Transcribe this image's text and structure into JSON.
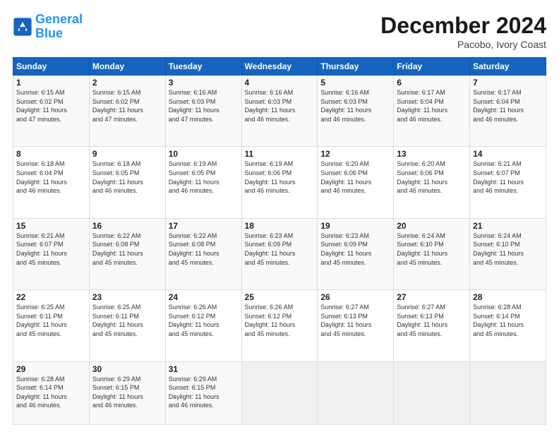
{
  "logo": {
    "line1": "General",
    "line2": "Blue"
  },
  "title": "December 2024",
  "subtitle": "Pacobo, Ivory Coast",
  "headers": [
    "Sunday",
    "Monday",
    "Tuesday",
    "Wednesday",
    "Thursday",
    "Friday",
    "Saturday"
  ],
  "weeks": [
    [
      {
        "day": "1",
        "info": "Sunrise: 6:15 AM\nSunset: 6:02 PM\nDaylight: 11 hours\nand 47 minutes."
      },
      {
        "day": "2",
        "info": "Sunrise: 6:15 AM\nSunset: 6:02 PM\nDaylight: 11 hours\nand 47 minutes."
      },
      {
        "day": "3",
        "info": "Sunrise: 6:16 AM\nSunset: 6:03 PM\nDaylight: 11 hours\nand 47 minutes."
      },
      {
        "day": "4",
        "info": "Sunrise: 6:16 AM\nSunset: 6:03 PM\nDaylight: 11 hours\nand 46 minutes."
      },
      {
        "day": "5",
        "info": "Sunrise: 6:16 AM\nSunset: 6:03 PM\nDaylight: 11 hours\nand 46 minutes."
      },
      {
        "day": "6",
        "info": "Sunrise: 6:17 AM\nSunset: 6:04 PM\nDaylight: 11 hours\nand 46 minutes."
      },
      {
        "day": "7",
        "info": "Sunrise: 6:17 AM\nSunset: 6:04 PM\nDaylight: 11 hours\nand 46 minutes."
      }
    ],
    [
      {
        "day": "8",
        "info": "Sunrise: 6:18 AM\nSunset: 6:04 PM\nDaylight: 11 hours\nand 46 minutes."
      },
      {
        "day": "9",
        "info": "Sunrise: 6:18 AM\nSunset: 6:05 PM\nDaylight: 11 hours\nand 46 minutes."
      },
      {
        "day": "10",
        "info": "Sunrise: 6:19 AM\nSunset: 6:05 PM\nDaylight: 11 hours\nand 46 minutes."
      },
      {
        "day": "11",
        "info": "Sunrise: 6:19 AM\nSunset: 6:06 PM\nDaylight: 11 hours\nand 46 minutes."
      },
      {
        "day": "12",
        "info": "Sunrise: 6:20 AM\nSunset: 6:06 PM\nDaylight: 11 hours\nand 46 minutes."
      },
      {
        "day": "13",
        "info": "Sunrise: 6:20 AM\nSunset: 6:06 PM\nDaylight: 11 hours\nand 46 minutes."
      },
      {
        "day": "14",
        "info": "Sunrise: 6:21 AM\nSunset: 6:07 PM\nDaylight: 11 hours\nand 46 minutes."
      }
    ],
    [
      {
        "day": "15",
        "info": "Sunrise: 6:21 AM\nSunset: 6:07 PM\nDaylight: 11 hours\nand 45 minutes."
      },
      {
        "day": "16",
        "info": "Sunrise: 6:22 AM\nSunset: 6:08 PM\nDaylight: 11 hours\nand 45 minutes."
      },
      {
        "day": "17",
        "info": "Sunrise: 6:22 AM\nSunset: 6:08 PM\nDaylight: 11 hours\nand 45 minutes."
      },
      {
        "day": "18",
        "info": "Sunrise: 6:23 AM\nSunset: 6:09 PM\nDaylight: 11 hours\nand 45 minutes."
      },
      {
        "day": "19",
        "info": "Sunrise: 6:23 AM\nSunset: 6:09 PM\nDaylight: 11 hours\nand 45 minutes."
      },
      {
        "day": "20",
        "info": "Sunrise: 6:24 AM\nSunset: 6:10 PM\nDaylight: 11 hours\nand 45 minutes."
      },
      {
        "day": "21",
        "info": "Sunrise: 6:24 AM\nSunset: 6:10 PM\nDaylight: 11 hours\nand 45 minutes."
      }
    ],
    [
      {
        "day": "22",
        "info": "Sunrise: 6:25 AM\nSunset: 6:11 PM\nDaylight: 11 hours\nand 45 minutes."
      },
      {
        "day": "23",
        "info": "Sunrise: 6:25 AM\nSunset: 6:11 PM\nDaylight: 11 hours\nand 45 minutes."
      },
      {
        "day": "24",
        "info": "Sunrise: 6:26 AM\nSunset: 6:12 PM\nDaylight: 11 hours\nand 45 minutes."
      },
      {
        "day": "25",
        "info": "Sunrise: 6:26 AM\nSunset: 6:12 PM\nDaylight: 11 hours\nand 45 minutes."
      },
      {
        "day": "26",
        "info": "Sunrise: 6:27 AM\nSunset: 6:13 PM\nDaylight: 11 hours\nand 45 minutes."
      },
      {
        "day": "27",
        "info": "Sunrise: 6:27 AM\nSunset: 6:13 PM\nDaylight: 11 hours\nand 45 minutes."
      },
      {
        "day": "28",
        "info": "Sunrise: 6:28 AM\nSunset: 6:14 PM\nDaylight: 11 hours\nand 45 minutes."
      }
    ],
    [
      {
        "day": "29",
        "info": "Sunrise: 6:28 AM\nSunset: 6:14 PM\nDaylight: 11 hours\nand 46 minutes."
      },
      {
        "day": "30",
        "info": "Sunrise: 6:29 AM\nSunset: 6:15 PM\nDaylight: 11 hours\nand 46 minutes."
      },
      {
        "day": "31",
        "info": "Sunrise: 6:29 AM\nSunset: 6:15 PM\nDaylight: 11 hours\nand 46 minutes."
      },
      null,
      null,
      null,
      null
    ]
  ]
}
